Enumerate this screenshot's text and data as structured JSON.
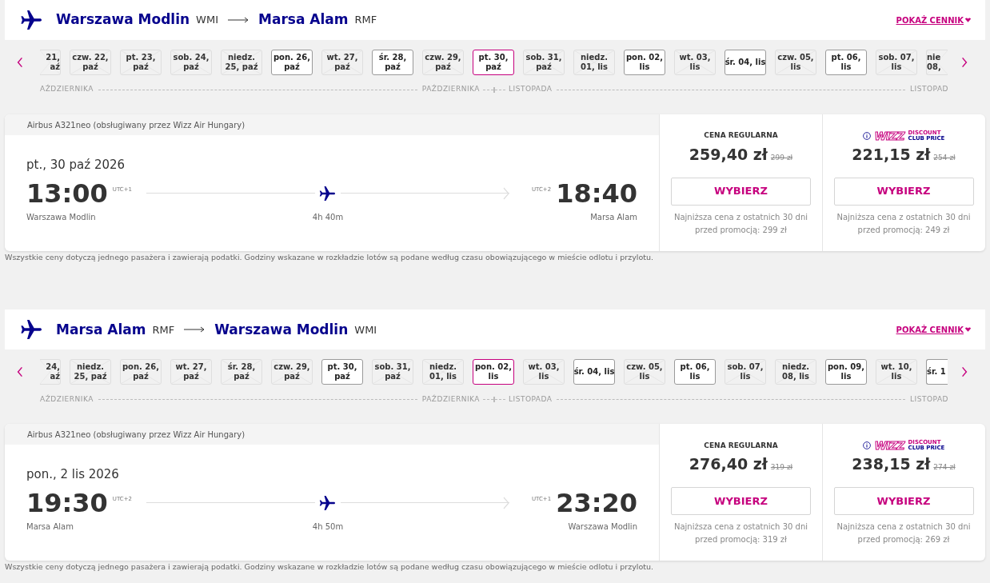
{
  "sections": [
    {
      "route": {
        "from_city": "Warszawa Modlin",
        "from_code": "WMI",
        "to_city": "Marsa Alam",
        "to_code": "RMF",
        "link": "POKAŻ CENNIK"
      },
      "days": [
        {
          "lines": [
            "21,",
            "aź"
          ],
          "kind": "partial_start",
          "selected": false,
          "available": false
        },
        {
          "lines": [
            "czw. 22,",
            "paź"
          ],
          "selected": false,
          "available": false
        },
        {
          "lines": [
            "pt. 23,",
            "paź"
          ],
          "selected": false,
          "available": false
        },
        {
          "lines": [
            "sob. 24,",
            "paź"
          ],
          "selected": false,
          "available": false
        },
        {
          "lines": [
            "niedz.",
            "25, paź"
          ],
          "selected": false,
          "available": false
        },
        {
          "lines": [
            "pon. 26,",
            "paź"
          ],
          "selected": false,
          "available": true
        },
        {
          "lines": [
            "wt. 27,",
            "paź"
          ],
          "selected": false,
          "available": false
        },
        {
          "lines": [
            "śr. 28,",
            "paź"
          ],
          "selected": false,
          "available": true
        },
        {
          "lines": [
            "czw. 29,",
            "paź"
          ],
          "selected": false,
          "available": false
        },
        {
          "lines": [
            "pt. 30,",
            "paź"
          ],
          "selected": true,
          "available": true
        },
        {
          "lines": [
            "sob. 31,",
            "paź"
          ],
          "selected": false,
          "available": false
        },
        {
          "lines": [
            "niedz.",
            "01, lis"
          ],
          "selected": false,
          "available": false
        },
        {
          "lines": [
            "pon. 02,",
            "lis"
          ],
          "selected": false,
          "available": true
        },
        {
          "lines": [
            "wt. 03,",
            "lis"
          ],
          "selected": false,
          "available": false
        },
        {
          "lines": [
            "śr. 04, lis"
          ],
          "selected": false,
          "available": true
        },
        {
          "lines": [
            "czw. 05,",
            "lis"
          ],
          "selected": false,
          "available": false
        },
        {
          "lines": [
            "pt. 06,",
            "lis"
          ],
          "selected": false,
          "available": true
        },
        {
          "lines": [
            "sob. 07,",
            "lis"
          ],
          "selected": false,
          "available": false
        },
        {
          "lines": [
            "nie",
            "08,"
          ],
          "kind": "partial_end",
          "selected": false,
          "available": false
        }
      ],
      "months": [
        {
          "start": "AŹDZIERNIKA",
          "end": "PAŹDZIERNIKA"
        },
        {
          "start": "LISTOPADA",
          "end": "LISTOPAD"
        }
      ],
      "flight": {
        "aircraft": "Airbus A321neo (obsługiwany przez Wizz Air Hungary)",
        "date": "pt., 30 paź 2026",
        "dep_time": "13:00",
        "dep_utc": "UTC+1",
        "dep_city": "Warszawa Modlin",
        "arr_time": "18:40",
        "arr_utc": "UTC+2",
        "arr_city": "Marsa Alam",
        "duration": "4h 40m"
      },
      "fares": [
        {
          "kind": "regular",
          "title": "CENA REGULARNA",
          "price": "259,40 zł",
          "old_price": "299 zł",
          "button": "WYBIERZ",
          "note": "Najniższa cena z ostatnich 30 dni przed promocją: 299 zł"
        },
        {
          "kind": "club",
          "logo": "WIZZ",
          "logo_top": "DISCOUNT",
          "logo_bottom": "CLUB PRICE",
          "price": "221,15 zł",
          "old_price": "254 zł",
          "button": "WYBIERZ",
          "note": "Najniższa cena z ostatnich 30 dni przed promocją: 249 zł"
        }
      ],
      "footnote": "Wszystkie ceny dotyczą jednego pasażera i zawierają podatki. Godziny wskazane w rozkładzie lotów są podane według czasu obowiązującego w mieście odlotu i przylotu."
    },
    {
      "route": {
        "from_city": "Marsa Alam",
        "from_code": "RMF",
        "to_city": "Warszawa Modlin",
        "to_code": "WMI",
        "link": "POKAŻ CENNIK"
      },
      "days": [
        {
          "lines": [
            "24,",
            "aź"
          ],
          "kind": "partial_start",
          "selected": false,
          "available": false
        },
        {
          "lines": [
            "niedz.",
            "25, paź"
          ],
          "selected": false,
          "available": false
        },
        {
          "lines": [
            "pon. 26,",
            "paź"
          ],
          "selected": false,
          "available": false
        },
        {
          "lines": [
            "wt. 27,",
            "paź"
          ],
          "selected": false,
          "available": false
        },
        {
          "lines": [
            "śr. 28,",
            "paź"
          ],
          "selected": false,
          "available": false
        },
        {
          "lines": [
            "czw. 29,",
            "paź"
          ],
          "selected": false,
          "available": false
        },
        {
          "lines": [
            "pt. 30,",
            "paź"
          ],
          "selected": false,
          "available": true
        },
        {
          "lines": [
            "sob. 31,",
            "paź"
          ],
          "selected": false,
          "available": false
        },
        {
          "lines": [
            "niedz.",
            "01, lis"
          ],
          "selected": false,
          "available": false
        },
        {
          "lines": [
            "pon. 02,",
            "lis"
          ],
          "selected": true,
          "available": true
        },
        {
          "lines": [
            "wt. 03,",
            "lis"
          ],
          "selected": false,
          "available": false
        },
        {
          "lines": [
            "śr. 04, lis"
          ],
          "selected": false,
          "available": true
        },
        {
          "lines": [
            "czw. 05,",
            "lis"
          ],
          "selected": false,
          "available": false
        },
        {
          "lines": [
            "pt. 06,",
            "lis"
          ],
          "selected": false,
          "available": true
        },
        {
          "lines": [
            "sob. 07,",
            "lis"
          ],
          "selected": false,
          "available": false
        },
        {
          "lines": [
            "niedz.",
            "08, lis"
          ],
          "selected": false,
          "available": false
        },
        {
          "lines": [
            "pon. 09,",
            "lis"
          ],
          "selected": false,
          "available": true
        },
        {
          "lines": [
            "wt. 10,",
            "lis"
          ],
          "selected": false,
          "available": false
        },
        {
          "lines": [
            "śr. 1"
          ],
          "kind": "partial_end",
          "selected": false,
          "available": true
        }
      ],
      "months": [
        {
          "start": "AŹDZIERNIKA",
          "end": "PAŹDZIERNIKA"
        },
        {
          "start": "LISTOPADA",
          "end": "LISTOPAD"
        }
      ],
      "flight": {
        "aircraft": "Airbus A321neo (obsługiwany przez Wizz Air Hungary)",
        "date": "pon., 2 lis 2026",
        "dep_time": "19:30",
        "dep_utc": "UTC+2",
        "dep_city": "Marsa Alam",
        "arr_time": "23:20",
        "arr_utc": "UTC+1",
        "arr_city": "Warszawa Modlin",
        "duration": "4h 50m"
      },
      "fares": [
        {
          "kind": "regular",
          "title": "CENA REGULARNA",
          "price": "276,40 zł",
          "old_price": "319 zł",
          "button": "WYBIERZ",
          "note": "Najniższa cena z ostatnich 30 dni przed promocją: 319 zł"
        },
        {
          "kind": "club",
          "logo": "WIZZ",
          "logo_top": "DISCOUNT",
          "logo_bottom": "CLUB PRICE",
          "price": "238,15 zł",
          "old_price": "274 zł",
          "button": "WYBIERZ",
          "note": "Najniższa cena z ostatnich 30 dni przed promocją: 269 zł"
        }
      ],
      "footnote": "Wszystkie ceny dotyczą jednego pasażera i zawierają podatki. Godziny wskazane w rozkładzie lotów są podane według czasu obowiązującego w mieście odlotu i przylotu."
    }
  ]
}
